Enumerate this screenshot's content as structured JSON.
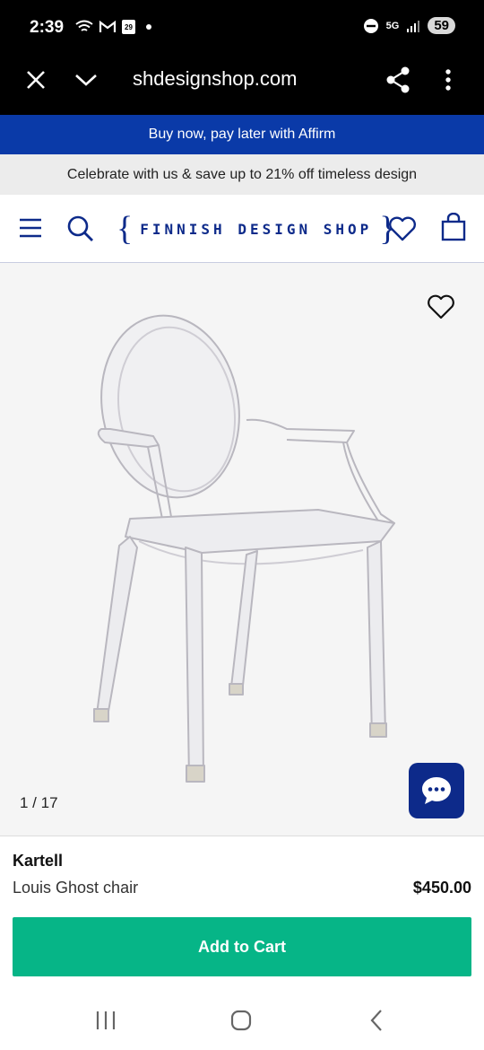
{
  "status_bar": {
    "time": "2:39",
    "network": "5G",
    "battery": "59",
    "calendar_day": "29"
  },
  "browser": {
    "url": "shdesignshop.com"
  },
  "banners": {
    "affirm": "Buy now, pay later with Affirm",
    "promo": "Celebrate with us & save up to 21% off timeless design"
  },
  "header": {
    "logo_left_brace": "{",
    "logo_text": "FINNISH DESIGN SHOP",
    "logo_right_brace": "}"
  },
  "product": {
    "image_counter": "1 / 17",
    "brand": "Kartell",
    "name": "Louis Ghost chair",
    "price": "$450.00",
    "add_to_cart_label": "Add to Cart"
  },
  "colors": {
    "brand_blue": "#0d2a8a",
    "affirm_blue": "#0a3aa8",
    "cart_green": "#06b587"
  },
  "icons": [
    "close-icon",
    "chevron-down-icon",
    "share-icon",
    "more-vert-icon",
    "menu-icon",
    "search-icon",
    "heart-icon",
    "bag-icon",
    "chat-icon"
  ]
}
